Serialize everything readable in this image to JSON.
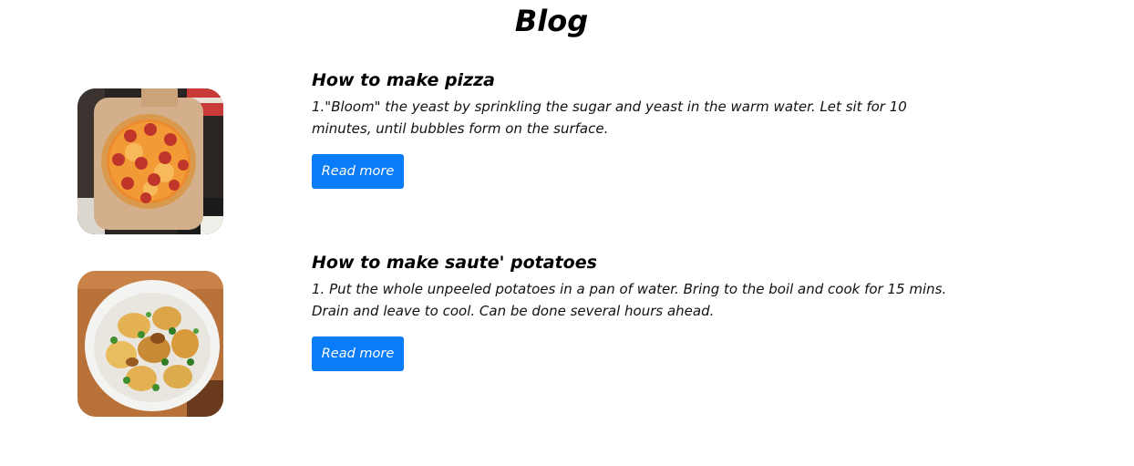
{
  "page": {
    "title": "Blog"
  },
  "posts": [
    {
      "title": "How to make pizza",
      "excerpt": "1.\"Bloom\" the yeast by sprinkling the sugar and yeast in the warm water. Let sit for 10 minutes, until bubbles form on the surface.",
      "button_label": "Read more",
      "image": "pizza-image"
    },
    {
      "title": "How to make saute' potatoes",
      "excerpt": "1. Put the whole unpeeled potatoes in a pan of water. Bring to the boil and cook for 15 mins. Drain and leave to cool. Can be done several hours ahead.",
      "button_label": "Read more",
      "image": "potatoes-image"
    }
  ],
  "colors": {
    "button_bg": "#0a7cf7",
    "button_text": "#ffffff",
    "title_text": "#000000"
  }
}
